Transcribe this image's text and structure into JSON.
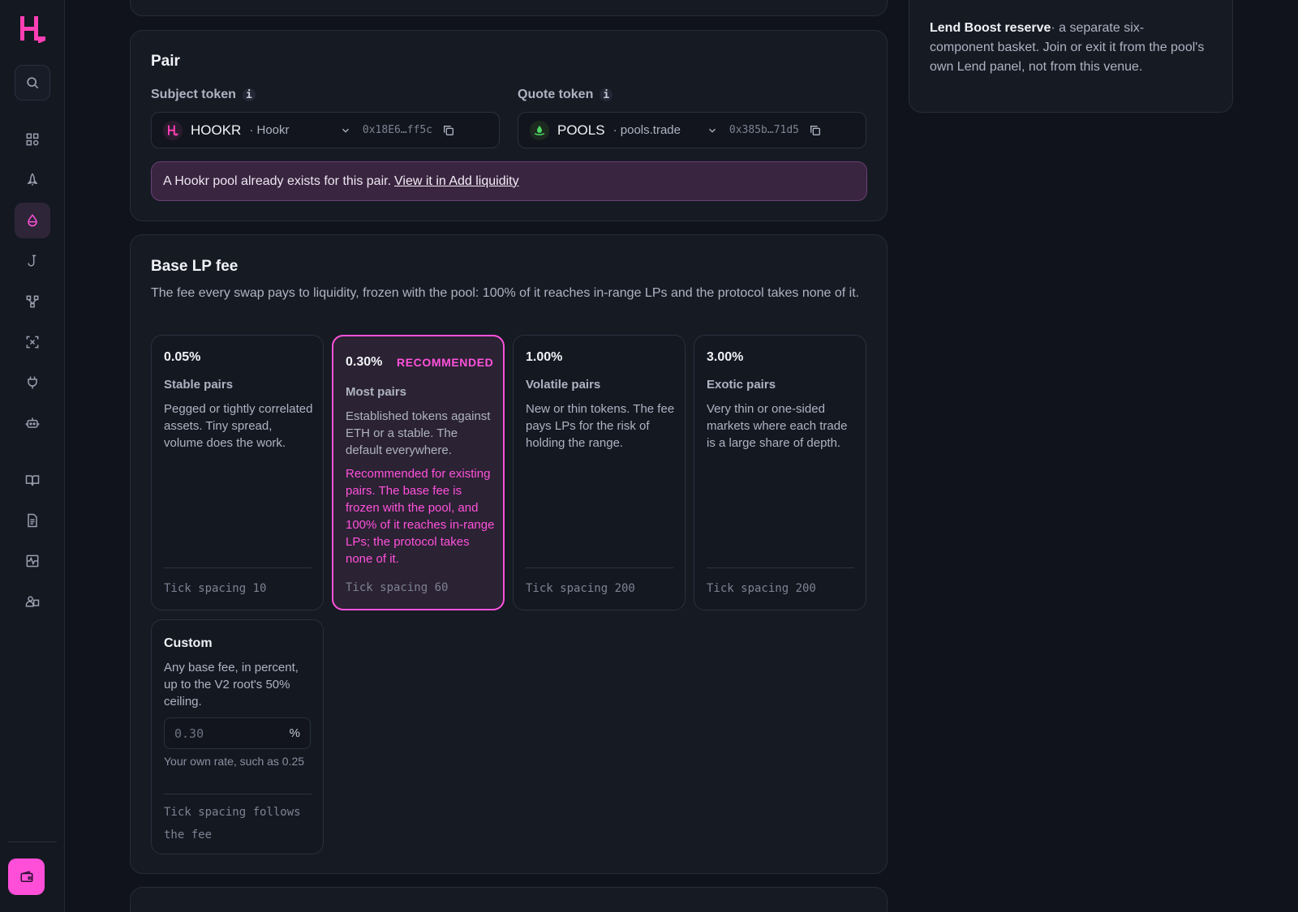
{
  "sidebar": {
    "logo_letter": "H",
    "nav_icons": [
      "search-icon",
      "grid-icon",
      "rocket-icon",
      "droplet-icon",
      "hook-icon",
      "network-icon",
      "scan-icon",
      "plug-icon",
      "robot-icon",
      "book-icon",
      "document-icon",
      "activity-icon",
      "users-icon"
    ],
    "wallet_icon": "wallet-icon",
    "accent_color": "#ff52dc"
  },
  "pair": {
    "title": "Pair",
    "subject_label": "Subject token",
    "quote_label": "Quote token",
    "info_glyph": "i",
    "subject": {
      "symbol": "HOOKR",
      "name": "· Hookr",
      "address": "0x18E6…ff5c"
    },
    "quote": {
      "symbol": "POOLS",
      "name": "· pools.trade",
      "address": "0x385b…71d5"
    },
    "notice_text": "A Hookr pool already exists for this pair.",
    "notice_link": "View it in Add liquidity"
  },
  "fee": {
    "title": "Base LP fee",
    "description": "The fee every swap pays to liquidity, frozen with the pool: 100% of it reaches in-range LPs and the protocol takes none of it.",
    "tiers": [
      {
        "pct": "0.05%",
        "name": "Stable pairs",
        "text": "Pegged or tightly correlated assets. Tiny spread, volume does the work.",
        "tick": "Tick spacing 10"
      },
      {
        "pct": "0.30%",
        "badge": "RECOMMENDED",
        "name": "Most pairs",
        "text": "Established tokens against ETH or a stable. The default everywhere.",
        "recommendation": "Recommended for existing pairs. The base fee is frozen with the pool, and 100% of it reaches in-range LPs; the protocol takes none of it.",
        "tick": "Tick spacing 60"
      },
      {
        "pct": "1.00%",
        "name": "Volatile pairs",
        "text": "New or thin tokens. The fee pays LPs for the risk of holding the range.",
        "tick": "Tick spacing 200"
      },
      {
        "pct": "3.00%",
        "name": "Exotic pairs",
        "text": "Very thin or one-sided markets where each trade is a large share of depth.",
        "tick": "Tick spacing 200"
      }
    ],
    "selected_tier": "0.30%",
    "custom": {
      "title": "Custom",
      "text": "Any base fee, in percent, up to the V2 root's 50% ceiling.",
      "placeholder": "0.30",
      "unit": "%",
      "hint": "Your own rate, such as 0.25",
      "tick": "Tick spacing follows the fee"
    }
  },
  "side": {
    "title": "Lend Boost reserve",
    "text": "· a separate six-component basket. Join or exit it from the pool's own Lend panel, not from this venue."
  }
}
